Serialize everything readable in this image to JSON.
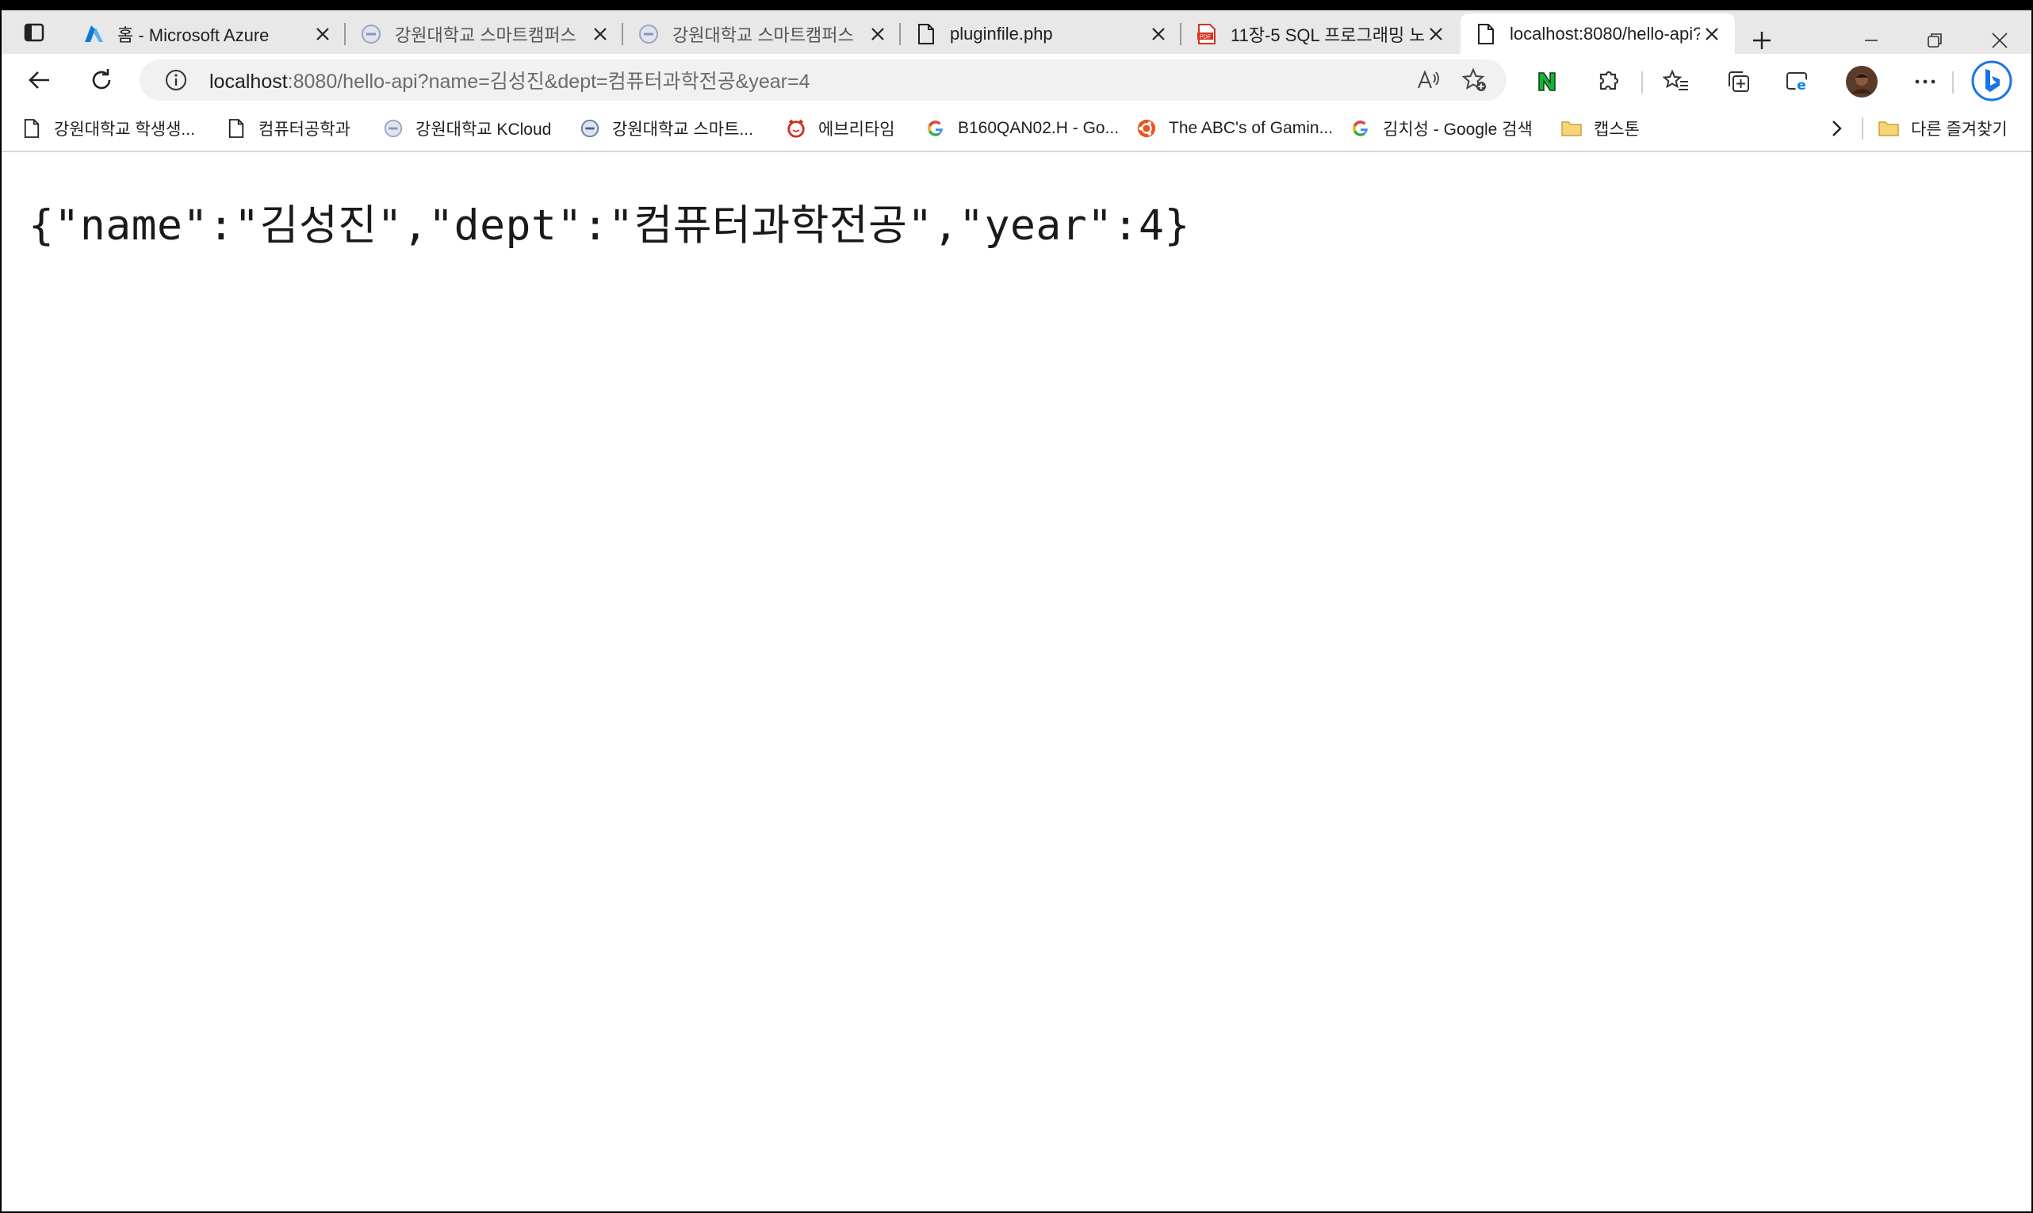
{
  "browser": {
    "tabs": [
      {
        "title": "홈 - Microsoft Azure",
        "icon": "azure-icon"
      },
      {
        "title": "강원대학교 스마트캠퍼스",
        "icon": "globe-icon"
      },
      {
        "title": "강원대학교 스마트캠퍼스",
        "icon": "globe-icon"
      },
      {
        "title": "pluginfile.php",
        "icon": "document-icon"
      },
      {
        "title": "11장-5 SQL 프로그래밍 노",
        "icon": "pdf-icon"
      },
      {
        "title": "localhost:8080/hello-api?",
        "icon": "document-icon",
        "active": true
      }
    ],
    "address": {
      "host": "localhost",
      "rest": ":8080/hello-api?name=김성진&dept=컴퓨터과학전공&year=4"
    },
    "bookmarks": [
      {
        "label": "강원대학교 학생생...",
        "icon": "document-icon"
      },
      {
        "label": "컴퓨터공학과",
        "icon": "document-icon"
      },
      {
        "label": "강원대학교 KCloud",
        "icon": "globe-icon"
      },
      {
        "label": "강원대학교 스마트...",
        "icon": "globe-icon"
      },
      {
        "label": "에브리타임",
        "icon": "everytime-icon"
      },
      {
        "label": "B160QAN02.H - Go...",
        "icon": "google-icon"
      },
      {
        "label": "The ABC's of Gamin...",
        "icon": "ubuntu-icon"
      },
      {
        "label": "김치성 - Google 검색",
        "icon": "google-icon"
      },
      {
        "label": "캡스톤",
        "icon": "folder-icon"
      }
    ],
    "other_bookmarks": "다른 즐겨찾기"
  },
  "page": {
    "json_text": "{\"name\":\"김성진\",\"dept\":\"컴퓨터과학전공\",\"year\":4}"
  },
  "colors": {
    "tabstrip_bg": "#e8e8e8",
    "omnibox_bg": "#f1f1f1",
    "pdf_red": "#d93025",
    "azure_blue": "#0a7ad6"
  }
}
